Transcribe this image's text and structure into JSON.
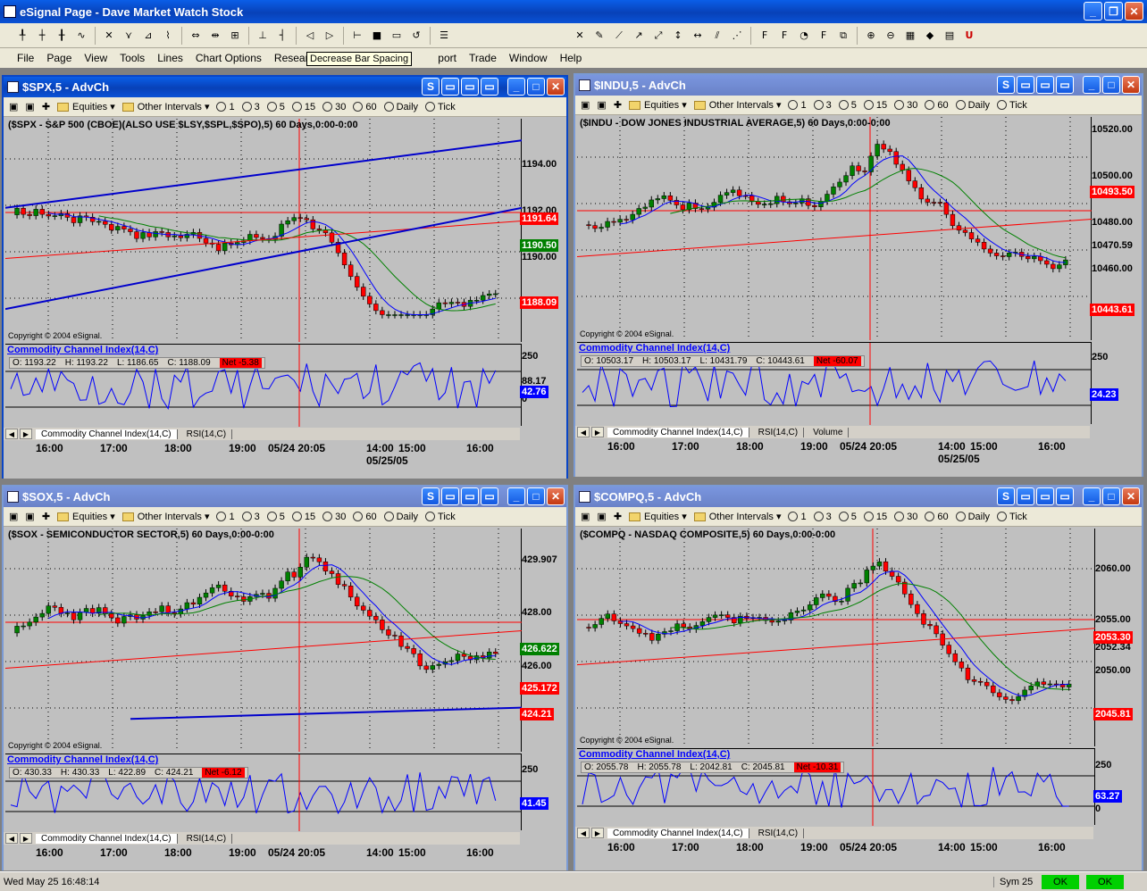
{
  "app": {
    "title": "eSignal Page - Dave Market Watch Stock"
  },
  "menu": [
    "File",
    "Page",
    "View",
    "Tools",
    "Lines",
    "Chart Options",
    "Research",
    "Sc",
    "",
    "port",
    "Trade",
    "Window",
    "Help"
  ],
  "tooltip": "Decrease Bar Spacing",
  "status": {
    "datetime": "Wed May 25 16:48:14",
    "sym": "Sym 25",
    "ok1": "OK",
    "ok2": "OK"
  },
  "chart_toolbar": {
    "equities": "Equities",
    "other": "Other Intervals",
    "intervals": [
      "1",
      "3",
      "5",
      "15",
      "30",
      "60",
      "Daily",
      "Tick"
    ]
  },
  "windows": [
    {
      "id": "spx",
      "title": "$SPX,5 - AdvCh",
      "header": "($SPX - S&P 500 (CBOE)(ALSO USE $LSY,$SPL,$SPO),5) 60 Days,0:00-0:00",
      "copyright": "Copyright © 2004 eSignal.",
      "indicator": "Commodity Channel Index(14,C)",
      "ohlc": {
        "o": "O: 1193.22",
        "h": "H: 1193.22",
        "l": "L: 1186.65",
        "c": "C: 1188.09",
        "net": "Net -5.38"
      },
      "scale": [
        "1194.00",
        "1192.00",
        "1190.00",
        "250",
        "88.17",
        "0"
      ],
      "tags": [
        "1191.64",
        "1190.50",
        "1188.09",
        "42.76"
      ],
      "tabs": [
        "Commodity Channel Index(14,C)",
        "RSI(14,C)"
      ],
      "times": [
        "16:00",
        "17:00",
        "18:00",
        "19:00",
        "05/24 20:05",
        "14:00",
        "15:00",
        "16:00"
      ],
      "date2": "05/25/05"
    },
    {
      "id": "indu",
      "title": "$INDU,5 - AdvCh",
      "header": "($INDU - DOW JONES INDUSTRIAL AVERAGE,5) 60 Days,0:00-0:00",
      "copyright": "Copyright © 2004 eSignal.",
      "indicator": "Commodity Channel Index(14,C)",
      "ohlc": {
        "o": "O: 10503.17",
        "h": "H: 10503.17",
        "l": "L: 10431.79",
        "c": "C: 10443.61",
        "net": "Net -60.07"
      },
      "scale": [
        "10520.00",
        "10500.00",
        "10480.00",
        "10460.00",
        "250"
      ],
      "tags": [
        "10493.50",
        "10470.59",
        "10443.61",
        "24.23"
      ],
      "tabs": [
        "Commodity Channel Index(14,C)",
        "RSI(14,C)",
        "Volume"
      ],
      "times": [
        "16:00",
        "17:00",
        "18:00",
        "19:00",
        "05/24 20:05",
        "14:00",
        "15:00",
        "16:00"
      ],
      "date2": "05/25/05"
    },
    {
      "id": "sox",
      "title": "$SOX,5 - AdvCh",
      "header": "($SOX - SEMICONDUCTOR SECTOR,5) 60 Days,0:00-0:00",
      "copyright": "Copyright © 2004 eSignal.",
      "indicator": "Commodity Channel Index(14,C)",
      "ohlc": {
        "o": "O: 430.33",
        "h": "H: 430.33",
        "l": "L: 422.89",
        "c": "C: 424.21",
        "net": "Net -6.12"
      },
      "scale": [
        "429.907",
        "428.00",
        "426.00",
        "250"
      ],
      "tags": [
        "426.622",
        "425.172",
        "424.21",
        "41.45"
      ],
      "tabs": [
        "Commodity Channel Index(14,C)",
        "RSI(14,C)"
      ],
      "times": [
        "16:00",
        "17:00",
        "18:00",
        "19:00",
        "05/24 20:05",
        "14:00",
        "15:00",
        "16:00"
      ],
      "date2": ""
    },
    {
      "id": "compq",
      "title": "$COMPQ,5 - AdvCh",
      "header": "($COMPQ - NASDAQ COMPOSITE,5) 60 Days,0:00-0:00",
      "copyright": "Copyright © 2004 eSignal.",
      "indicator": "Commodity Channel Index(14,C)",
      "ohlc": {
        "o": "O: 2055.78",
        "h": "H: 2055.78",
        "l": "L: 2042.81",
        "c": "C: 2045.81",
        "net": "Net -10.31"
      },
      "scale": [
        "2060.00",
        "2055.00",
        "2052.34",
        "2050.00",
        "250",
        "0"
      ],
      "tags": [
        "2053.30",
        "2045.81",
        "63.27"
      ],
      "tabs": [
        "Commodity Channel Index(14,C)",
        "RSI(14,C)"
      ],
      "times": [
        "16:00",
        "17:00",
        "18:00",
        "19:00",
        "05/24 20:05",
        "14:00",
        "15:00",
        "16:00"
      ],
      "date2": ""
    }
  ],
  "colors": {
    "up": "#008000",
    "down": "#ff0000",
    "ma_fast": "#0000ff",
    "ma_mid": "#008000",
    "ma_slow": "#ff0000",
    "trend": "#0000cc"
  },
  "chart_data": [
    {
      "type": "candlestick",
      "symbol": "$SPX",
      "interval": "5 min",
      "last": 1188.09,
      "open": 1193.22,
      "high": 1193.22,
      "low": 1186.65,
      "change": -5.38,
      "cci": 42.76
    },
    {
      "type": "candlestick",
      "symbol": "$INDU",
      "interval": "5 min",
      "last": 10443.61,
      "open": 10503.17,
      "high": 10503.17,
      "low": 10431.79,
      "change": -60.07,
      "cci": 24.23
    },
    {
      "type": "candlestick",
      "symbol": "$SOX",
      "interval": "5 min",
      "last": 424.21,
      "open": 430.33,
      "high": 430.33,
      "low": 422.89,
      "change": -6.12,
      "cci": 41.45
    },
    {
      "type": "candlestick",
      "symbol": "$COMPQ",
      "interval": "5 min",
      "last": 2045.81,
      "open": 2055.78,
      "high": 2055.78,
      "low": 2042.81,
      "change": -10.31,
      "cci": 63.27
    }
  ]
}
